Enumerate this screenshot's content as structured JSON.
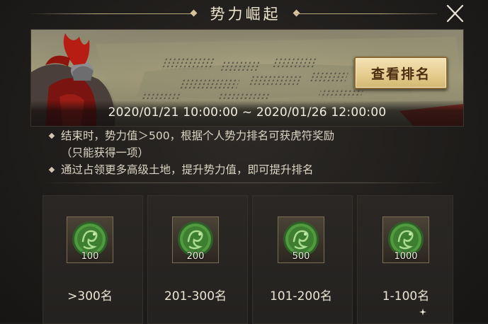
{
  "dialog": {
    "title": "势力崛起",
    "close_icon": "close-x-icon"
  },
  "banner": {
    "rank_button_label": "查看排名",
    "date_range": "2020/01/21 10:00:00 ~ 2020/01/26 12:00:00"
  },
  "rules": [
    {
      "text": "结束时，势力值＞500，根据个人势力排名可获虎符奖励"
    },
    {
      "text": "（只能获得一项）"
    },
    {
      "text": "通过占领更多高级土地，提升势力值，即可提升排名"
    }
  ],
  "rewards": [
    {
      "amount": "100",
      "rank": ">300名",
      "icon": "tiger-token-icon"
    },
    {
      "amount": "200",
      "rank": "201-300名",
      "icon": "tiger-token-icon"
    },
    {
      "amount": "500",
      "rank": "101-200名",
      "icon": "tiger-token-icon"
    },
    {
      "amount": "1000",
      "rank": "1-100名",
      "icon": "tiger-token-icon"
    }
  ],
  "colors": {
    "background": "#1f1d1b",
    "accent_gold": "#e6cd90",
    "text": "#ece5d4",
    "token_green": "#4f9b3e"
  }
}
